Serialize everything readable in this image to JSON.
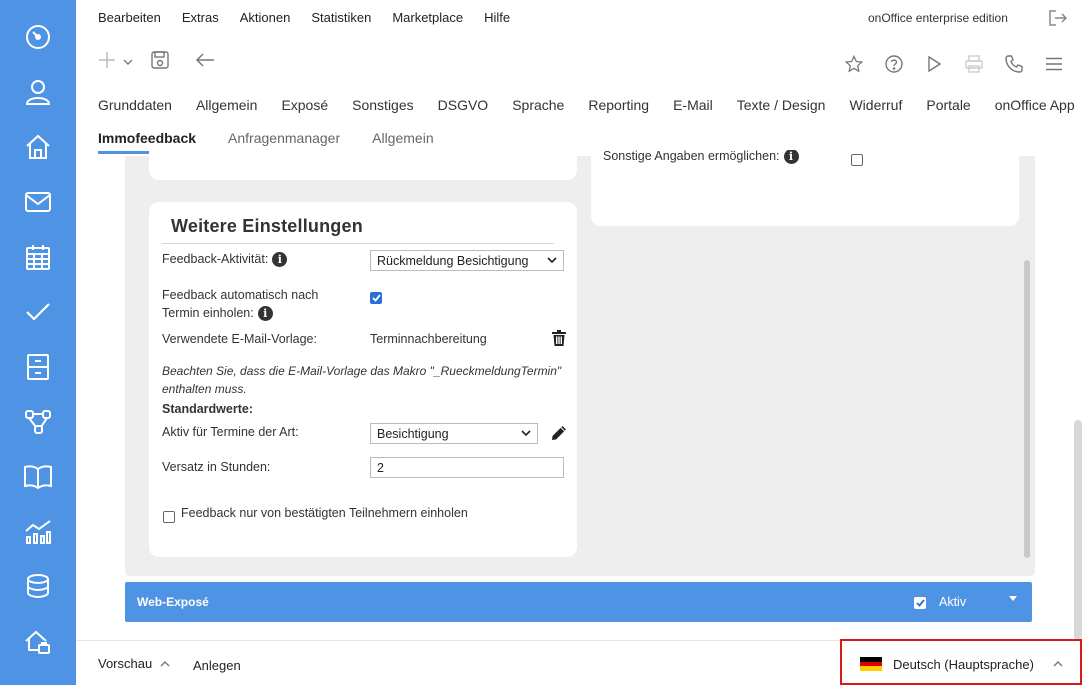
{
  "menu": [
    "Bearbeiten",
    "Extras",
    "Aktionen",
    "Statistiken",
    "Marketplace",
    "Hilfe"
  ],
  "edition": "onOffice enterprise edition",
  "tabs_primary": [
    "Grunddaten",
    "Allgemein",
    "Exposé",
    "Sonstiges",
    "DSGVO",
    "Sprache",
    "Reporting",
    "E-Mail",
    "Texte / Design",
    "Widerruf",
    "Portale",
    "onOffice App"
  ],
  "tabs_secondary": [
    "Immofeedback",
    "Anfragenmanager",
    "Allgemein"
  ],
  "active_secondary_tab": "Immofeedback",
  "right_card": {
    "partial_label": "Sonstige Angaben ermöglichen:"
  },
  "settings": {
    "title": "Weitere Einstellungen",
    "feedback_activity_label": "Feedback-Aktivität:",
    "feedback_activity_value": "Rückmeldung Besichtigung",
    "auto_feedback_label_line1": "Feedback automatisch nach",
    "auto_feedback_label_line2": "Termin einholen:",
    "auto_feedback_checked": true,
    "email_template_label": "Verwendete E-Mail-Vorlage:",
    "email_template_value": "Terminnachbereitung",
    "note": "Beachten Sie, dass die E-Mail-Vorlage das Makro \"_RueckmeldungTermin\" enthalten muss.",
    "defaults_heading": "Standardwerte:",
    "active_for_label": "Aktiv für Termine der Art:",
    "active_for_value": "Besichtigung",
    "offset_label": "Versatz in Stunden:",
    "offset_value": "2",
    "confirmed_only_label": "Feedback nur von bestätigten Teilnehmern einholen",
    "confirmed_only_checked": false
  },
  "web_expose": {
    "title": "Web-Exposé",
    "active_label": "Aktiv",
    "active_checked": true
  },
  "bottom": {
    "preview_label": "Vorschau",
    "create_label": "Anlegen",
    "language_label": "Deutsch (Hauptsprache)"
  },
  "colors": {
    "sidebar": "#4f94e4",
    "accent": "#4f94e4",
    "checkbox": "#2b6ed8",
    "highlight_border": "#d91a1a"
  }
}
